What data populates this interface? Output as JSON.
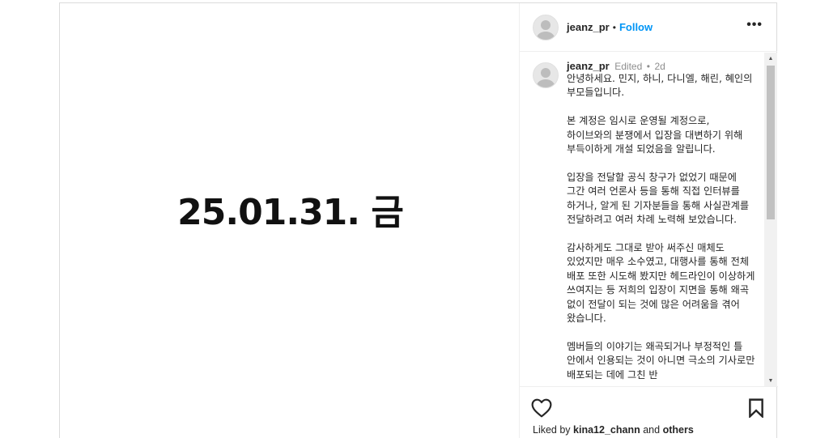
{
  "media": {
    "text": "25.01.31. 금"
  },
  "header": {
    "username": "jeanz_pr",
    "separator": "•",
    "follow_label": "Follow",
    "more_icon": "more-horizontal-icon"
  },
  "comment": {
    "username": "jeanz_pr",
    "edited": "Edited",
    "separator": "•",
    "time_ago": "2d",
    "caption": "안녕하세요. 민지, 하니, 다니엘, 해린, 혜인의 부모들입니다.\n\n본 계정은 임시로 운영될 계정으로, 하이브와의 분쟁에서 입장을 대변하기 위해 부득이하게 개설 되었음을 알립니다.\n\n입장을 전달할 공식 창구가 없었기 때문에 그간 여러 언론사 등을 통해 직접 인터뷰를 하거나, 알게 된 기자분들을 통해 사실관계를 전달하려고 여러 차례 노력해 보았습니다.\n\n감사하게도 그대로 받아 써주신 매체도 있었지만 매우 소수였고, 대행사를 통해 전체 배포 또한 시도해 봤지만 헤드라인이 이상하게 쓰여지는 등 저희의 입장이 지면을 통해 왜곡 없이 전달이 되는 것에 많은 어려움을 겪어 왔습니다.\n\n멤버들의 이야기는 왜곡되거나 부정적인 틀 안에서 인용되는 것이 아니면 극소의 기사로만 배포되는 데에 그친 반"
  },
  "actions": {
    "like_icon": "heart-icon",
    "save_icon": "bookmark-icon",
    "liked_by_prefix": "Liked by",
    "liked_by_user": "kina12_chann",
    "liked_by_and": "and",
    "liked_by_others": "others"
  },
  "colors": {
    "accent": "#0095f6",
    "text": "#262626",
    "muted": "#8e8e8e",
    "border": "#dbdbdb"
  }
}
